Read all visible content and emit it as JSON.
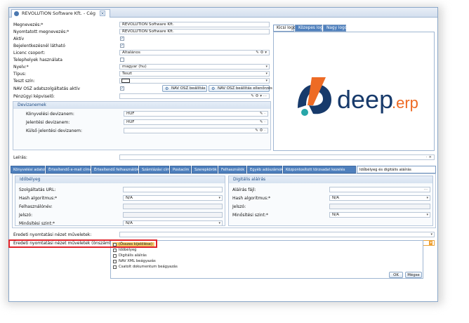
{
  "window": {
    "tab_title": "REVOLUTION Software Kft. - Cég",
    "close_symbol": "×"
  },
  "form": {
    "megnevezes": {
      "label": "Megnevezés:*",
      "value": "REVOLUTION Software Kft."
    },
    "nyomtatott": {
      "label": "Nyomtatott megnevezés:*",
      "value": "REVOLUTION Software Kft."
    },
    "aktiv": {
      "label": "Aktív",
      "checked": "✓"
    },
    "bejelentkezes": {
      "label": "Bejelentkezésnél látható",
      "checked": "✓"
    },
    "licenc": {
      "label": "Licenc csoport:",
      "value": "Általános",
      "tools": "✎ ⚙ ▾"
    },
    "telephelyek": {
      "label": "Telephelyek használata"
    },
    "nyelv": {
      "label": "Nyelv:*",
      "value": "magyar (hu)"
    },
    "tipus": {
      "label": "Típus:",
      "value": "Teszt"
    },
    "teszt_szin": {
      "label": "Teszt szín:"
    },
    "nav": {
      "label": "NAV OSZ adatszolgáltatás aktív",
      "checked": "✓",
      "btn1": "NAV OSZ beállítás",
      "btn2": "NAV OSZ beállítás ellenőrzés"
    },
    "penzugyi": {
      "label": "Pénzügyi képviselő:",
      "tools": "✎ ⚙ ▾ ···"
    },
    "devizanemek": {
      "title": "Devizanemek",
      "konyvelesi": {
        "label": "Könyvelési devizanem:",
        "value": "HUF",
        "tools": "✎ ·"
      },
      "jelentesi": {
        "label": "Jelentési devizanem:",
        "value": "HUF",
        "tools": "✎ ·"
      },
      "kulso": {
        "label": "Külső jelentési devizanem:",
        "tools": "✎ ⚙ ·"
      }
    },
    "leiras": {
      "label": "Leírás:",
      "tools": "· ×"
    }
  },
  "logo_tabs": [
    "Kicsi logo",
    "Közepes logo",
    "Nagy logo"
  ],
  "logo": {
    "brand": "deep",
    "suffix": ".erp",
    "colors": {
      "navy": "#173a6b",
      "orange": "#ee6b25",
      "teal": "#27a6a8"
    }
  },
  "bottom_tabs": [
    "Könyvelési adatok",
    "Értesítendő e-mail címek",
    "Értesítendő felhasználók",
    "Számlázási cím",
    "Postacím",
    "Szerepkörök",
    "Felhasználók",
    "Egyéb adószámok",
    "Központosított törzsadat kezelés",
    "Időbélyeg és digitális aláírás"
  ],
  "idobelyeg": {
    "title": "Időbélyeg",
    "url": {
      "label": "Szolgáltatás URL:"
    },
    "hash": {
      "label": "Hash algoritmus:*",
      "value": "N/A"
    },
    "user": {
      "label": "Felhasználónév:"
    },
    "pass": {
      "label": "Jelszó:"
    },
    "level": {
      "label": "Minősítési szint:*",
      "value": "N/A"
    }
  },
  "digitalis": {
    "title": "Digitális aláírás",
    "file": {
      "label": "Aláírás fájl:",
      "tools": "···"
    },
    "hash": {
      "label": "Hash algoritmus:*",
      "value": "N/A"
    },
    "pass": {
      "label": "Jelszó:"
    },
    "level": {
      "label": "Minősítési szint:*",
      "value": "N/A"
    }
  },
  "eredeti": {
    "label": "Eredeti nyomtatási nézet műveletek:"
  },
  "eredeti_onszamlazas": {
    "label": "Eredeti nyomtatási nézet műveletek (önszámlázás):"
  },
  "popup": {
    "options": [
      "(Összes kijelölése)",
      "Időbélyeg",
      "Digitális aláírás",
      "NAV XML beágyazás",
      "Csatolt dokumentum beágyazás"
    ],
    "ok": "OK",
    "cancel": "Mégse"
  }
}
